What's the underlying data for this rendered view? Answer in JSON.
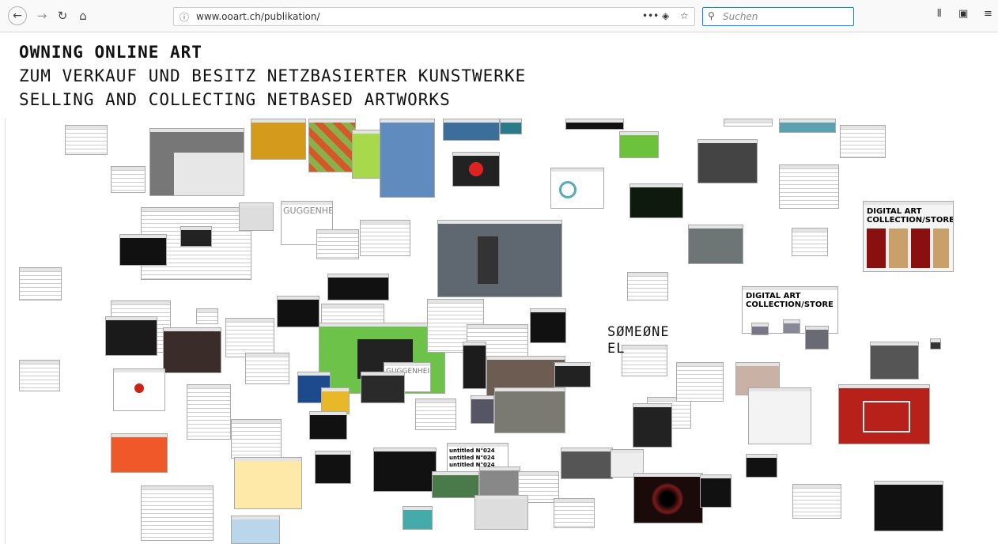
{
  "browser": {
    "url": "www.ooart.ch/publikation/",
    "search_placeholder": "Suchen",
    "icons": [
      "back-icon",
      "forward-icon",
      "reload-icon",
      "home-icon",
      "info-icon",
      "page-actions-icon",
      "pocket-icon",
      "bookmark-star-icon",
      "search-icon",
      "library-icon",
      "sidebar-icon",
      "menu-icon"
    ]
  },
  "page": {
    "title": "OWNING ONLINE ART",
    "subtitle_de": "ZUM VERKAUF UND BESITZ NETZBASIERTER KUNSTWERKE",
    "subtitle_en": "SELLING AND COLLECTING NETBASED ARTWORKS",
    "collage_texts": {
      "guggenheim_1": "GUGGENHEIM",
      "guggenheim_2": "GUGGENHEIM",
      "digital_art_store_1_line1": "DIGITAL ART",
      "digital_art_store_1_line2": "COLLECTION/STORE",
      "digital_art_store_2_line1": "DIGITAL ART",
      "digital_art_store_2_line2": "COLLECTION/STORE",
      "someone_line1": "SØMEØNE",
      "someone_line2": "EL",
      "untitled_1": "untitled N°024",
      "untitled_2": "untitled N°024",
      "untitled_3": "untitled N°024"
    }
  }
}
